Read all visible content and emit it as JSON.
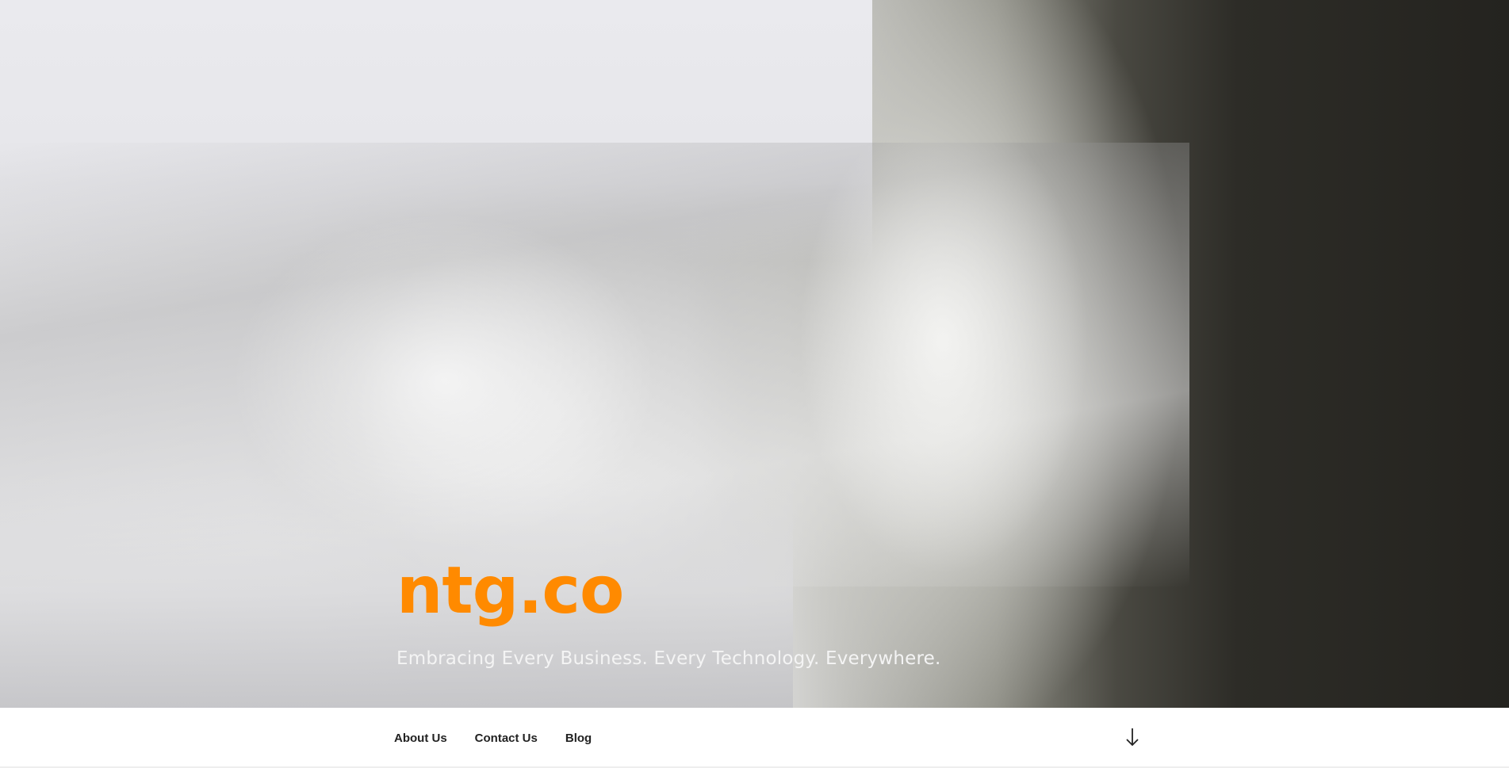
{
  "site": {
    "title": "ntg.co",
    "tagline": "Embracing Every Business. Every Technology. Everywhere."
  },
  "hero": {
    "image_icon": "waterfall-photo"
  },
  "nav": {
    "items": [
      {
        "label": "About Us"
      },
      {
        "label": "Contact Us"
      },
      {
        "label": "Blog"
      }
    ],
    "scroll_icon": "arrow-down-icon"
  },
  "colors": {
    "title": "#ff8a00",
    "tagline": "#f4f4f4",
    "nav_text": "#222222",
    "nav_bg": "#ffffff"
  }
}
